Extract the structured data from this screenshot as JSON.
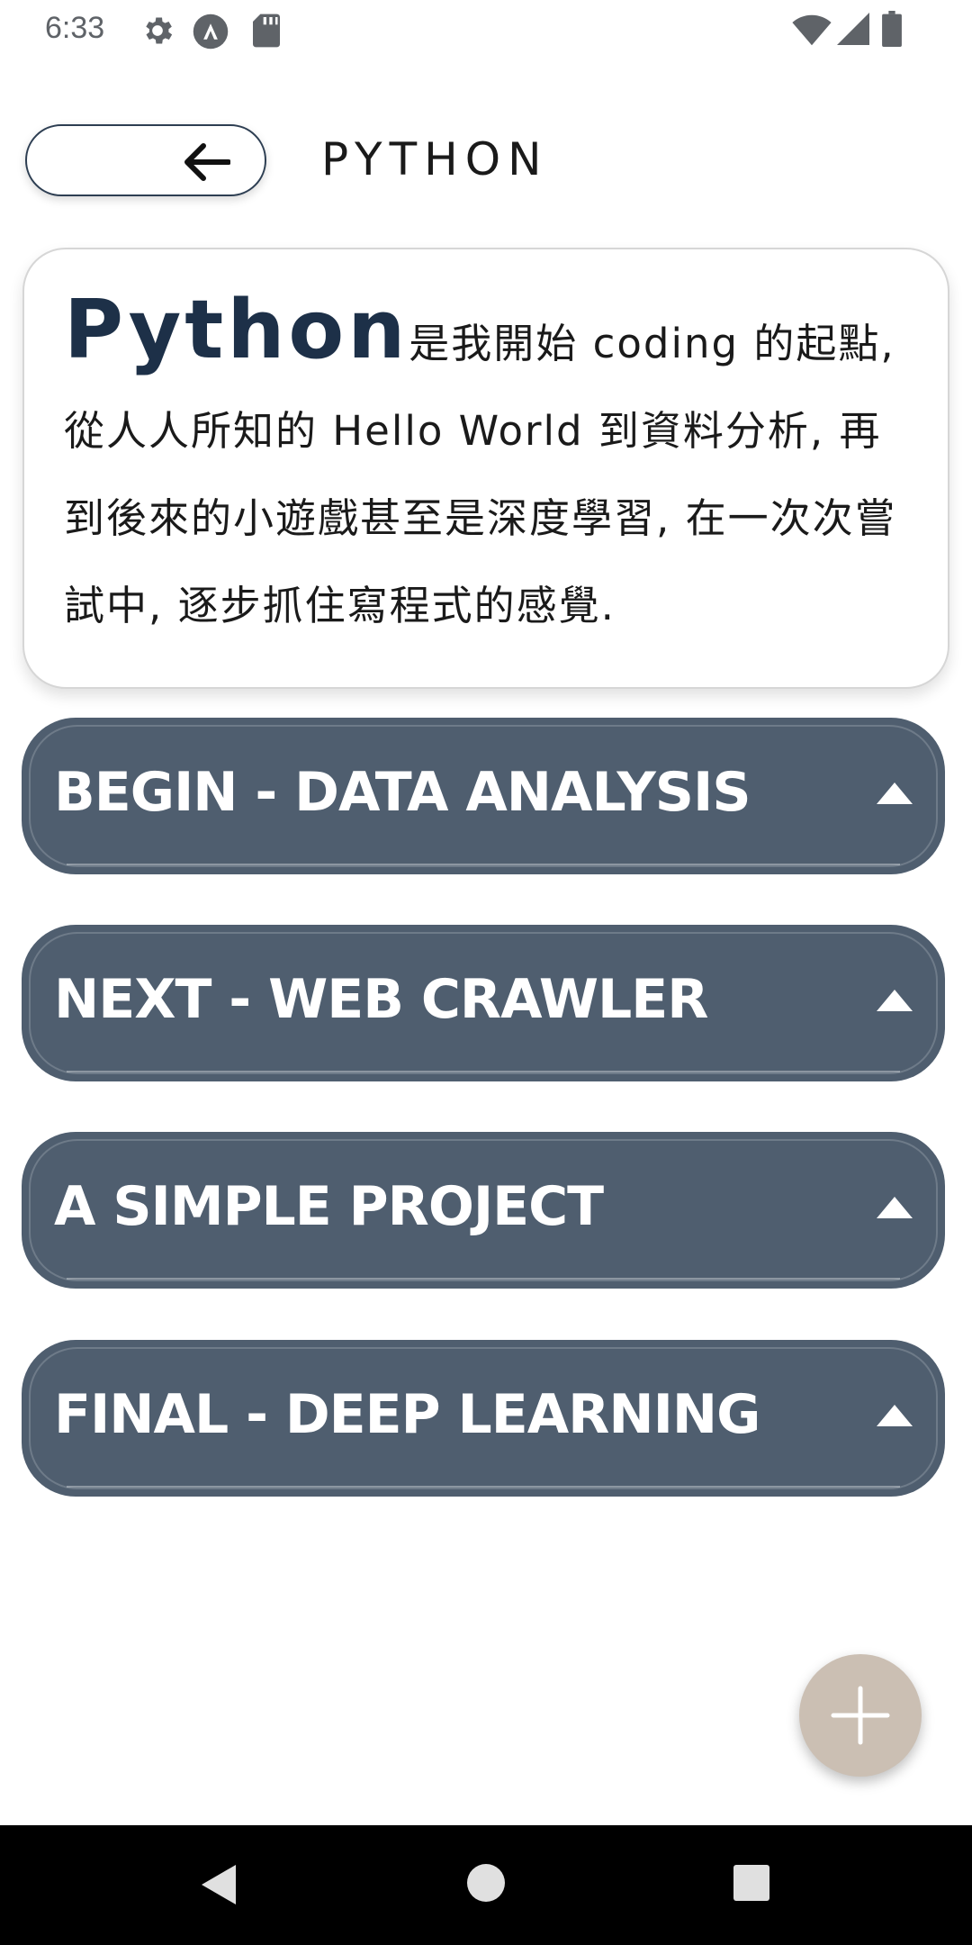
{
  "status_bar": {
    "time": "6:33",
    "icons": [
      "gear-icon",
      "a-badge-icon",
      "sd-card-icon"
    ],
    "right_icons": [
      "wifi-icon",
      "signal-icon",
      "battery-icon"
    ]
  },
  "header": {
    "back_icon": "arrow-left-icon",
    "title": "PYTHON"
  },
  "intro": {
    "lead": "Python",
    "text": "是我開始 coding 的起點, 從人人所知的 Hello World 到資料分析, 再到後來的小遊戲甚至是深度學習, 在一次次嘗試中, 逐步抓住寫程式的感覺."
  },
  "sections": [
    {
      "title": "BEGIN - DATA ANALYSIS",
      "expanded": true
    },
    {
      "title": "NEXT - WEB CRAWLER",
      "expanded": true
    },
    {
      "title": "A SIMPLE PROJECT",
      "expanded": true
    },
    {
      "title": "FINAL - DEEP LEARNING",
      "expanded": true
    }
  ],
  "fab": {
    "icon": "plus-icon"
  },
  "nav": {
    "icons": [
      "back-triangle-icon",
      "home-circle-icon",
      "recents-square-icon"
    ]
  },
  "colors": {
    "section_bg": "#4f5e6f",
    "title_dark": "#1d3048",
    "fab_bg": "#cbbfb3"
  }
}
